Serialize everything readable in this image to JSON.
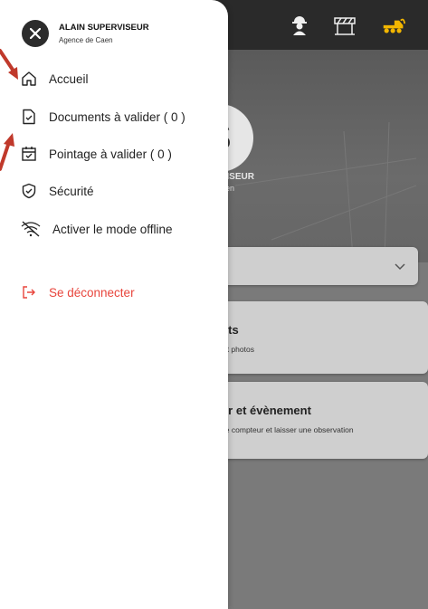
{
  "app": {
    "hero_initial": "S",
    "hero_name": "ERVISEUR",
    "hero_agency": "e Caen",
    "cards": [
      {
        "title": "ents",
        "desc": "ts et photos"
      },
      {
        "title": "eur et évènement",
        "desc": "er le compteur et laisser une observation"
      }
    ]
  },
  "drawer": {
    "user_name": "ALAIN SUPERVISEUR",
    "user_agency": "Agence de Caen",
    "menu": [
      {
        "label": "Accueil",
        "icon": "home-icon"
      },
      {
        "label": "Documents à valider ( 0 )",
        "icon": "document-check-icon"
      },
      {
        "label": "Pointage à valider ( 0 )",
        "icon": "calendar-check-icon"
      },
      {
        "label": "Sécurité",
        "icon": "shield-check-icon"
      },
      {
        "label": "Activer le mode offline",
        "icon": "wifi-off-icon"
      }
    ],
    "logout_label": "Se déconnecter"
  },
  "colors": {
    "logout": "#e8453c",
    "accent_yellow": "#f2b600",
    "annotation_arrow": "#c0392b"
  }
}
